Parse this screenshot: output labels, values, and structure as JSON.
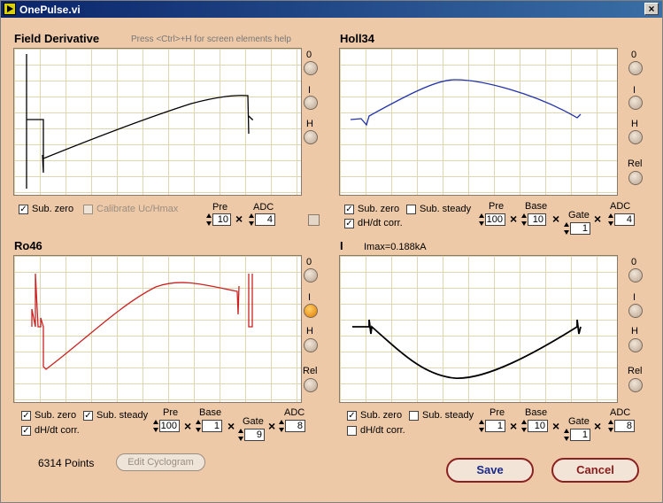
{
  "window": {
    "title": "OnePulse.vi",
    "close_glyph": "×"
  },
  "hint": "Press <Ctrl>+H for screen elements help",
  "panels": {
    "field": {
      "title": "Field Derivative"
    },
    "holl": {
      "title": "Holl34"
    },
    "ro": {
      "title": "Ro46"
    },
    "current": {
      "title": "I",
      "imax": "Imax=0.188kA"
    }
  },
  "knob_labels": {
    "zero": "0",
    "i": "I",
    "h": "H",
    "rel": "Rel"
  },
  "controls": {
    "sub_zero": "Sub. zero",
    "sub_steady": "Sub. steady",
    "dhdt": "dH/dt corr.",
    "calibrate": "Calibrate Uc/Hmax",
    "pre": "Pre",
    "base": "Base",
    "gate": "Gate",
    "adc": "ADC",
    "times": "×",
    "check": "✓"
  },
  "field_ctrl": {
    "pre": "10",
    "adc": "4"
  },
  "holl_ctrl": {
    "pre": "100",
    "base": "10",
    "gate": "1",
    "adc": "4"
  },
  "ro_ctrl": {
    "pre": "100",
    "base": "1",
    "gate": "9",
    "adc": "8"
  },
  "i_ctrl": {
    "pre": "1",
    "base": "10",
    "gate": "1",
    "adc": "8"
  },
  "footer": {
    "points": "6314 Points",
    "edit_cyclogram": "Edit Cyclogram",
    "save": "Save",
    "cancel": "Cancel"
  },
  "colors": {
    "field_trace": "#000000",
    "holl_trace": "#2233aa",
    "ro_trace": "#cc2222",
    "i_trace": "#000000",
    "knob_active": "#e07a00"
  }
}
